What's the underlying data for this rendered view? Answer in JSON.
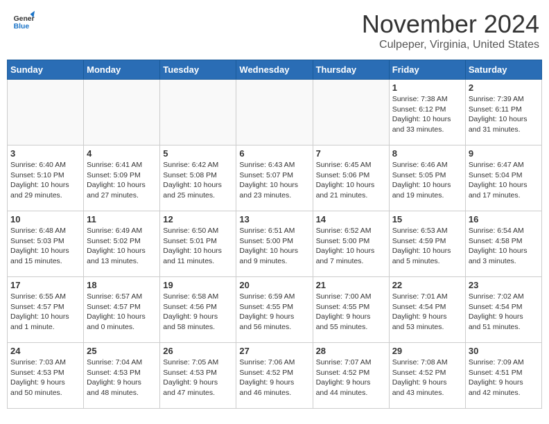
{
  "header": {
    "logo_line1": "General",
    "logo_line2": "Blue",
    "month": "November 2024",
    "location": "Culpeper, Virginia, United States"
  },
  "weekdays": [
    "Sunday",
    "Monday",
    "Tuesday",
    "Wednesday",
    "Thursday",
    "Friday",
    "Saturday"
  ],
  "weeks": [
    [
      {
        "day": "",
        "info": ""
      },
      {
        "day": "",
        "info": ""
      },
      {
        "day": "",
        "info": ""
      },
      {
        "day": "",
        "info": ""
      },
      {
        "day": "",
        "info": ""
      },
      {
        "day": "1",
        "info": "Sunrise: 7:38 AM\nSunset: 6:12 PM\nDaylight: 10 hours\nand 33 minutes."
      },
      {
        "day": "2",
        "info": "Sunrise: 7:39 AM\nSunset: 6:11 PM\nDaylight: 10 hours\nand 31 minutes."
      }
    ],
    [
      {
        "day": "3",
        "info": "Sunrise: 6:40 AM\nSunset: 5:10 PM\nDaylight: 10 hours\nand 29 minutes."
      },
      {
        "day": "4",
        "info": "Sunrise: 6:41 AM\nSunset: 5:09 PM\nDaylight: 10 hours\nand 27 minutes."
      },
      {
        "day": "5",
        "info": "Sunrise: 6:42 AM\nSunset: 5:08 PM\nDaylight: 10 hours\nand 25 minutes."
      },
      {
        "day": "6",
        "info": "Sunrise: 6:43 AM\nSunset: 5:07 PM\nDaylight: 10 hours\nand 23 minutes."
      },
      {
        "day": "7",
        "info": "Sunrise: 6:45 AM\nSunset: 5:06 PM\nDaylight: 10 hours\nand 21 minutes."
      },
      {
        "day": "8",
        "info": "Sunrise: 6:46 AM\nSunset: 5:05 PM\nDaylight: 10 hours\nand 19 minutes."
      },
      {
        "day": "9",
        "info": "Sunrise: 6:47 AM\nSunset: 5:04 PM\nDaylight: 10 hours\nand 17 minutes."
      }
    ],
    [
      {
        "day": "10",
        "info": "Sunrise: 6:48 AM\nSunset: 5:03 PM\nDaylight: 10 hours\nand 15 minutes."
      },
      {
        "day": "11",
        "info": "Sunrise: 6:49 AM\nSunset: 5:02 PM\nDaylight: 10 hours\nand 13 minutes."
      },
      {
        "day": "12",
        "info": "Sunrise: 6:50 AM\nSunset: 5:01 PM\nDaylight: 10 hours\nand 11 minutes."
      },
      {
        "day": "13",
        "info": "Sunrise: 6:51 AM\nSunset: 5:00 PM\nDaylight: 10 hours\nand 9 minutes."
      },
      {
        "day": "14",
        "info": "Sunrise: 6:52 AM\nSunset: 5:00 PM\nDaylight: 10 hours\nand 7 minutes."
      },
      {
        "day": "15",
        "info": "Sunrise: 6:53 AM\nSunset: 4:59 PM\nDaylight: 10 hours\nand 5 minutes."
      },
      {
        "day": "16",
        "info": "Sunrise: 6:54 AM\nSunset: 4:58 PM\nDaylight: 10 hours\nand 3 minutes."
      }
    ],
    [
      {
        "day": "17",
        "info": "Sunrise: 6:55 AM\nSunset: 4:57 PM\nDaylight: 10 hours\nand 1 minute."
      },
      {
        "day": "18",
        "info": "Sunrise: 6:57 AM\nSunset: 4:57 PM\nDaylight: 10 hours\nand 0 minutes."
      },
      {
        "day": "19",
        "info": "Sunrise: 6:58 AM\nSunset: 4:56 PM\nDaylight: 9 hours\nand 58 minutes."
      },
      {
        "day": "20",
        "info": "Sunrise: 6:59 AM\nSunset: 4:55 PM\nDaylight: 9 hours\nand 56 minutes."
      },
      {
        "day": "21",
        "info": "Sunrise: 7:00 AM\nSunset: 4:55 PM\nDaylight: 9 hours\nand 55 minutes."
      },
      {
        "day": "22",
        "info": "Sunrise: 7:01 AM\nSunset: 4:54 PM\nDaylight: 9 hours\nand 53 minutes."
      },
      {
        "day": "23",
        "info": "Sunrise: 7:02 AM\nSunset: 4:54 PM\nDaylight: 9 hours\nand 51 minutes."
      }
    ],
    [
      {
        "day": "24",
        "info": "Sunrise: 7:03 AM\nSunset: 4:53 PM\nDaylight: 9 hours\nand 50 minutes."
      },
      {
        "day": "25",
        "info": "Sunrise: 7:04 AM\nSunset: 4:53 PM\nDaylight: 9 hours\nand 48 minutes."
      },
      {
        "day": "26",
        "info": "Sunrise: 7:05 AM\nSunset: 4:53 PM\nDaylight: 9 hours\nand 47 minutes."
      },
      {
        "day": "27",
        "info": "Sunrise: 7:06 AM\nSunset: 4:52 PM\nDaylight: 9 hours\nand 46 minutes."
      },
      {
        "day": "28",
        "info": "Sunrise: 7:07 AM\nSunset: 4:52 PM\nDaylight: 9 hours\nand 44 minutes."
      },
      {
        "day": "29",
        "info": "Sunrise: 7:08 AM\nSunset: 4:52 PM\nDaylight: 9 hours\nand 43 minutes."
      },
      {
        "day": "30",
        "info": "Sunrise: 7:09 AM\nSunset: 4:51 PM\nDaylight: 9 hours\nand 42 minutes."
      }
    ]
  ]
}
